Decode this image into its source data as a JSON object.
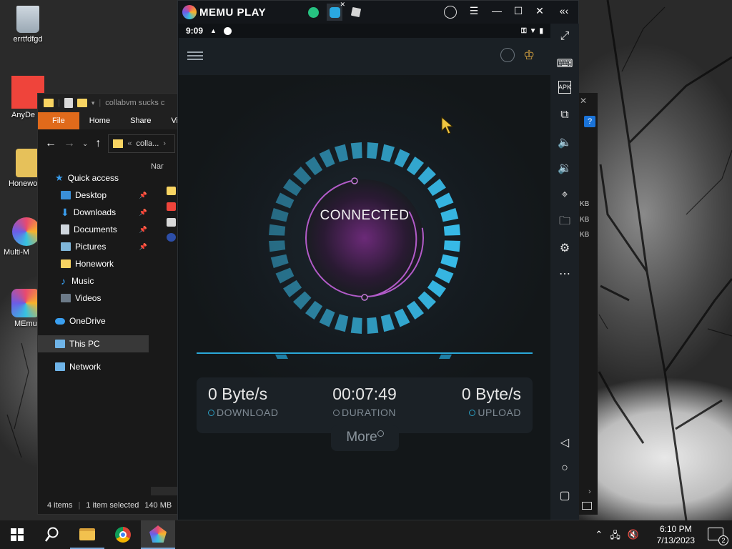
{
  "desktop": {
    "icons": [
      {
        "label": "errtfdfgd",
        "icon": "recycle-bin-icon"
      },
      {
        "label": "AnyDe",
        "icon": "anydesk-icon"
      },
      {
        "label": "Honewo",
        "icon": "folder-icon"
      },
      {
        "label": "Multi-M",
        "icon": "multi-memu-icon"
      },
      {
        "label": "MEmu",
        "icon": "memu-icon"
      }
    ]
  },
  "explorer": {
    "title": "collabvm sucks c",
    "ribbon_tabs": [
      "File",
      "Home",
      "Share",
      "Vi"
    ],
    "path": "colla...",
    "path_prefix": "«",
    "column_header": "Nar",
    "nav": {
      "quick_access": "Quick access",
      "items": [
        "Desktop",
        "Downloads",
        "Documents",
        "Pictures",
        "Honework",
        "Music",
        "Videos"
      ],
      "onedrive": "OneDrive",
      "this_pc": "This PC",
      "network": "Network"
    },
    "status": {
      "items": "4 items",
      "selected": "1 item selected",
      "size": "140 MB"
    }
  },
  "right_window": {
    "sizes": [
      "KB",
      "KB",
      "KB"
    ]
  },
  "memu": {
    "app_name": "MEMU PLAY",
    "android": {
      "time": "9:09",
      "vpn": {
        "status": "CONNECTED",
        "download": {
          "value": "0 Byte/s",
          "label": "DOWNLOAD"
        },
        "duration": {
          "value": "00:07:49",
          "label": "DURATION"
        },
        "upload": {
          "value": "0 Byte/s",
          "label": "UPLOAD"
        },
        "more_label": "More"
      }
    },
    "sidebar": {
      "buttons": [
        "fullscreen-icon",
        "keyboard-icon",
        "apk-icon",
        "multi-window-icon",
        "volume-up-icon",
        "volume-down-icon",
        "location-icon",
        "folder-icon",
        "settings-icon",
        "more-icon",
        "back-icon",
        "home-icon",
        "recents-icon"
      ],
      "apk_label": "APK"
    }
  },
  "taskbar": {
    "time": "6:10 PM",
    "date": "7/13/2023",
    "notification_count": "2"
  },
  "colors": {
    "ring_accent": "#37b9e6",
    "ring_inner": "#b25bc9",
    "file_tab": "#e06a1b"
  }
}
